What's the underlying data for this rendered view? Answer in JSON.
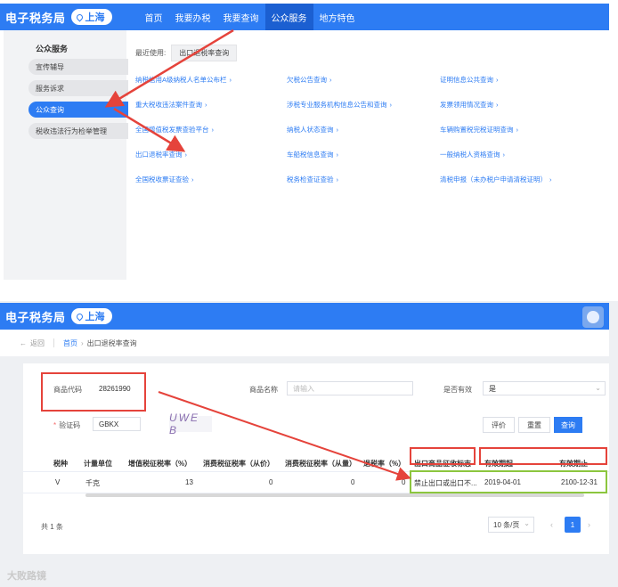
{
  "app": {
    "logo": "电子税务局",
    "location": "上海"
  },
  "screen1": {
    "nav": [
      "首页",
      "我要办税",
      "我要查询",
      "公众服务",
      "地方特色"
    ],
    "sidebar": {
      "title": "公众服务",
      "items": [
        "宣传辅导",
        "服务诉求",
        "公众查询",
        "税收违法行为检举管理"
      ]
    },
    "recent": {
      "label": "最近使用:",
      "chip": "出口退税率查询"
    },
    "links": [
      [
        "纳税信用A级纳税人名单公布栏",
        "欠税公告查询",
        "证明信息公共查询"
      ],
      [
        "重大税收违法案件查询",
        "涉税专业服务机构信息公告和查询",
        "发票领用情况查询"
      ],
      [
        "全国增值税发票查验平台",
        "纳税人状态查询",
        "车辆购置税完税证明查询"
      ],
      [
        "出口退税率查询",
        "车船税信息查询",
        "一般纳税人资格查询"
      ],
      [
        "全国税收票证查验",
        "税务检查证查验",
        "清税申报（未办税户申请清税证明）"
      ]
    ]
  },
  "screen2": {
    "back": "返回",
    "breadcrumb": {
      "home": "首页",
      "current": "出口退税率查询"
    },
    "form": {
      "code_label": "商品代码",
      "code_value": "28261990",
      "name_label": "商品名称",
      "name_placeholder": "请输入",
      "valid_label": "是否有效",
      "valid_value": "是",
      "captcha_label": "验证码",
      "captcha_value": "GBKX",
      "captcha_image_text": "UWE B"
    },
    "buttons": {
      "evaluate": "评价",
      "reset": "重置",
      "query": "查询"
    },
    "table": {
      "headers": [
        "税种",
        "计量单位",
        "增值税征税率（%）",
        "消费税征税率（从价）",
        "消费税征税率（从量）",
        "退税率（%）",
        "出口商品征收标志",
        "有效期起",
        "有效期止"
      ],
      "rows": [
        [
          "V",
          "千克",
          "13",
          "0",
          "0",
          "0",
          "禁止出口或出口不...",
          "2019-04-01",
          "2100-12-31"
        ]
      ]
    },
    "pagination": {
      "total": "共 1 条",
      "page_size": "10 条/页",
      "current": "1"
    },
    "watermark": "大败路镜"
  },
  "colors": {
    "brand": "#2d7cf3",
    "annotation_red": "#e5433b",
    "annotation_green": "#8cc63e"
  }
}
